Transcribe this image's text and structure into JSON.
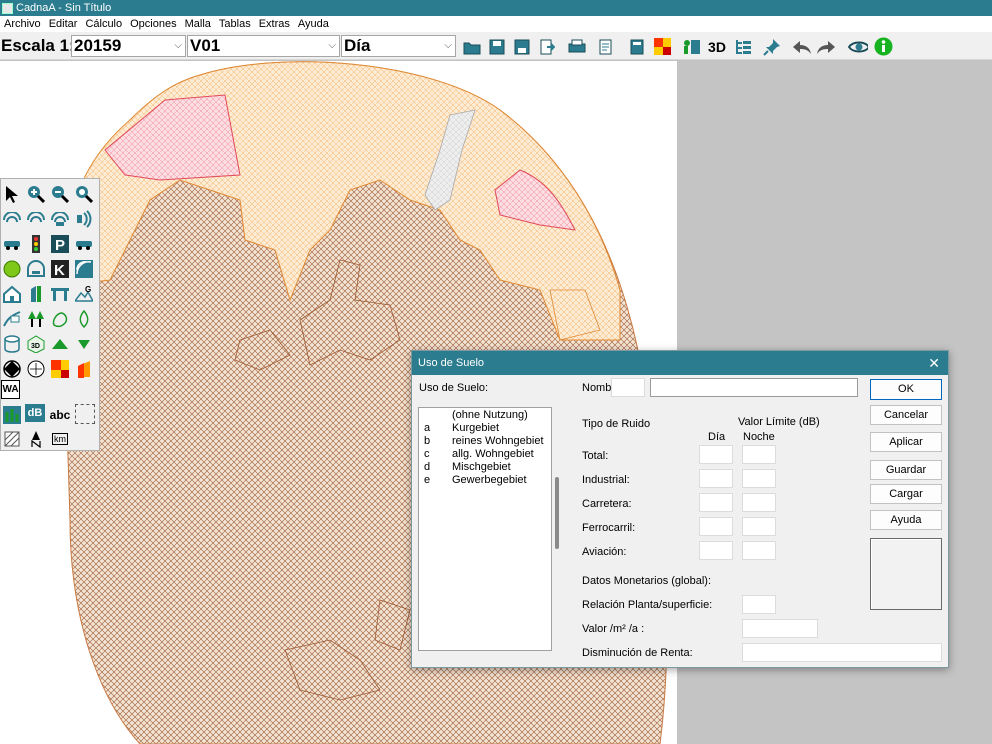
{
  "window": {
    "title": "CadnaA - Sin Título"
  },
  "menu": [
    "Archivo",
    "Editar",
    "Cálculo",
    "Opciones",
    "Malla",
    "Tablas",
    "Extras",
    "Ayuda"
  ],
  "toolbar": {
    "scale_label": "Escala 1:",
    "scale_value": "20159",
    "variant_value": "V01",
    "period_value": "Día",
    "three_d_label": "3D",
    "icons": [
      "open-folder-icon",
      "save-icon",
      "save-as-icon",
      "export-icon",
      "print-icon",
      "print-preview-icon",
      "calculator-icon",
      "grid-color-icon",
      "objects-icon",
      "3d-view-icon",
      "object-tree-icon",
      "pin-icon",
      "undo-icon",
      "redo-icon",
      "eye-icon",
      "info-icon"
    ]
  },
  "palette": {
    "labels": {
      "wa": "WA",
      "db": "dB",
      "abc": "abc",
      "km": "km",
      "three_d": "3D"
    }
  },
  "dialog": {
    "title": "Uso de Suelo",
    "close_glyph": "✕",
    "list_label": "Uso de Suelo:",
    "list_items": [
      {
        "key": "",
        "label": "(ohne Nutzung)"
      },
      {
        "key": "a",
        "label": "Kurgebiet"
      },
      {
        "key": "b",
        "label": "reines Wohngebiet"
      },
      {
        "key": "c",
        "label": "allg. Wohngebiet"
      },
      {
        "key": "d",
        "label": "Mischgebiet"
      },
      {
        "key": "e",
        "label": "Gewerbegebiet"
      }
    ],
    "name_label": "Nomb",
    "name_short_value": "",
    "name_long_value": "",
    "noise_type_header": "Tipo de Ruido",
    "limit_header": "Valor Límite (dB)",
    "day_header": "Día",
    "night_header": "Noche",
    "noise_rows": [
      {
        "label": "Total:",
        "day": "",
        "night": ""
      },
      {
        "label": "Industrial:",
        "day": "",
        "night": ""
      },
      {
        "label": "Carretera:",
        "day": "",
        "night": ""
      },
      {
        "label": "Ferrocarril:",
        "day": "",
        "night": ""
      },
      {
        "label": "Aviación:",
        "day": "",
        "night": ""
      }
    ],
    "monetary_label": "Datos Monetarios (global):",
    "ratio_label": "Relación Planta/superficie:",
    "value_label": "Valor /m² /a :",
    "rent_label": "Disminución de Renta:",
    "ratio_value": "",
    "value_value": "",
    "rent_value": "",
    "buttons": {
      "ok": "OK",
      "cancel": "Cancelar",
      "apply": "Aplicar",
      "save": "Guardar",
      "load": "Cargar",
      "help": "Ayuda"
    }
  },
  "colors": {
    "titlebar": "#2b7c8f",
    "map_brown": "#9c5a33",
    "map_orange": "#f7c58a",
    "map_pink": "#f08a9a",
    "map_gray": "#cfcfcf"
  }
}
